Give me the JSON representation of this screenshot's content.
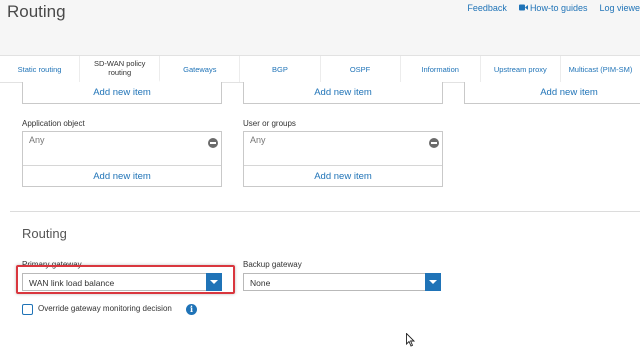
{
  "header": {
    "title": "Routing",
    "links": {
      "feedback": "Feedback",
      "how_to": "How-to guides",
      "log_viewer": "Log viewe"
    }
  },
  "tabs": [
    {
      "label": "Static routing"
    },
    {
      "label": "SD-WAN policy routing",
      "active": true
    },
    {
      "label": "Gateways"
    },
    {
      "label": "BGP"
    },
    {
      "label": "OSPF"
    },
    {
      "label": "Information"
    },
    {
      "label": "Upstream proxy"
    },
    {
      "label": "Multicast (PIM-SM)"
    }
  ],
  "add_new_item": "Add new item",
  "application_object": {
    "label": "Application object",
    "value": "Any",
    "add": "Add new item"
  },
  "user_or_groups": {
    "label": "User or groups",
    "value": "Any",
    "add": "Add new item"
  },
  "routing": {
    "title": "Routing",
    "primary_gateway": {
      "label": "Primary gateway",
      "value": "WAN link load balance"
    },
    "backup_gateway": {
      "label": "Backup gateway",
      "value": "None"
    },
    "override_checkbox": {
      "label": "Override gateway monitoring decision",
      "checked": false
    }
  },
  "colors": {
    "accent": "#1f73b7",
    "highlight": "#d9363e"
  },
  "icons": {
    "video": "video-icon",
    "remove": "minus-circle-icon",
    "info": "info-icon",
    "dropdown": "chevron-down-icon",
    "cursor": "mouse-pointer-icon"
  }
}
